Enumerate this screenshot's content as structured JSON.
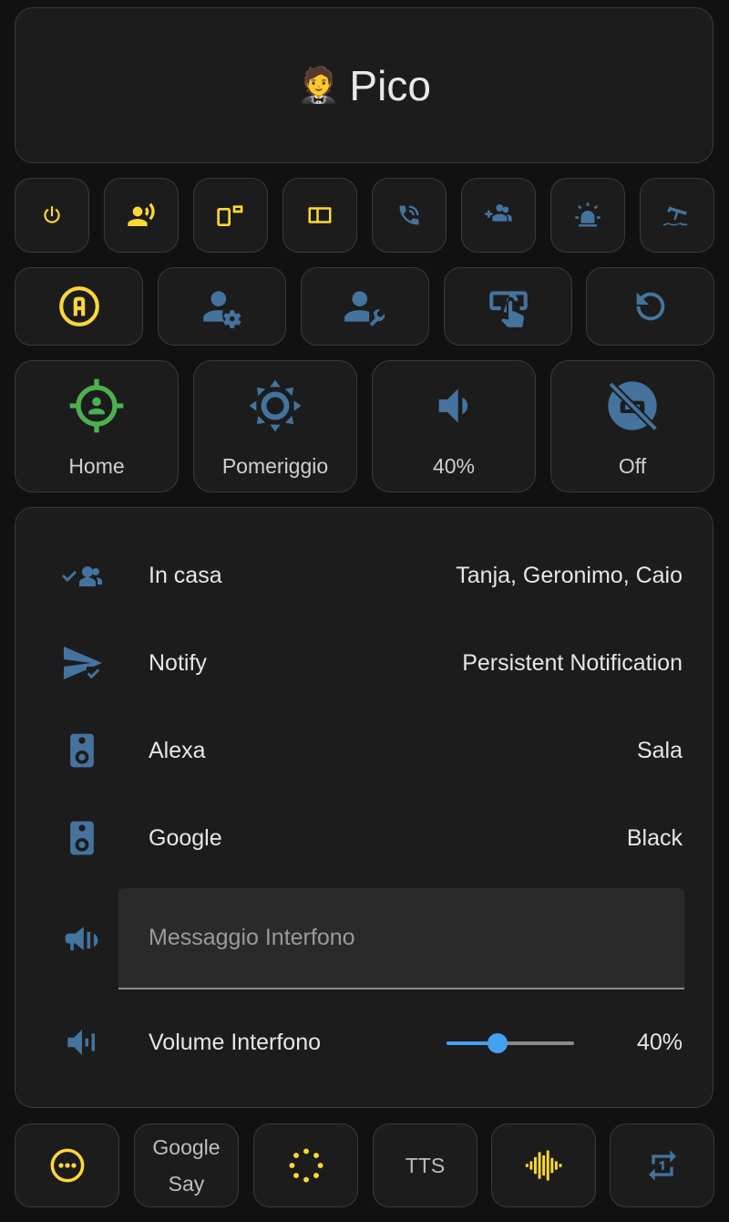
{
  "header": {
    "emoji": "🤵",
    "title": "Pico"
  },
  "colors": {
    "accent": "#fdd835",
    "icon_blue": "#44739e",
    "home_green": "#4caf50",
    "slider": "#44a1f2"
  },
  "row1_buttons": [
    {
      "icon": "power-icon",
      "color": "#fdd835"
    },
    {
      "icon": "account-voice-icon",
      "color": "#fdd835"
    },
    {
      "icon": "devices-icon",
      "color": "#fdd835"
    },
    {
      "icon": "page-layout-sidebar-icon",
      "color": "#fdd835"
    },
    {
      "icon": "phone-in-talk-icon",
      "color": "#44739e"
    },
    {
      "icon": "account-multiple-plus-icon",
      "color": "#44739e"
    },
    {
      "icon": "alarm-light-icon",
      "color": "#44739e"
    },
    {
      "icon": "beach-icon",
      "color": "#44739e"
    }
  ],
  "row2_buttons": [
    {
      "icon": "alpha-a-circle-icon",
      "color": "#fdd835"
    },
    {
      "icon": "account-cog-icon",
      "color": "#44739e"
    },
    {
      "icon": "account-wrench-icon",
      "color": "#44739e"
    },
    {
      "icon": "gesture-tap-button-icon",
      "color": "#44739e"
    },
    {
      "icon": "restart-icon",
      "color": "#44739e"
    }
  ],
  "tiles": [
    {
      "icon": "target-account-icon",
      "label": "Home",
      "color": "#4caf50"
    },
    {
      "icon": "brightness-icon",
      "label": "Pomeriggio",
      "color": "#44739e"
    },
    {
      "icon": "volume-medium-icon",
      "label": "40%",
      "color": "#44739e"
    },
    {
      "icon": "robot-off-icon",
      "label": "Off",
      "color": "#44739e"
    }
  ],
  "entities": {
    "rows": [
      {
        "icon": "account-multiple-check-icon",
        "name": "In casa",
        "value": "Tanja, Geronimo, Caio"
      },
      {
        "icon": "send-check-icon",
        "name": "Notify",
        "value": "Persistent Notification"
      },
      {
        "icon": "speaker-icon",
        "name": "Alexa",
        "value": "Sala"
      },
      {
        "icon": "speaker-icon",
        "name": "Google",
        "value": "Black"
      }
    ],
    "intercom": {
      "icon": "bullhorn-icon",
      "placeholder": "Messaggio Interfono"
    },
    "volume": {
      "icon": "volume-source-icon",
      "name": "Volume Interfono",
      "value": "40%",
      "level": 0.4
    }
  },
  "bottom_buttons": [
    {
      "icon": "dots-horizontal-circle-icon",
      "label": ""
    },
    {
      "icon": "",
      "label": "Google Say"
    },
    {
      "icon": "dots-circle-icon",
      "label": ""
    },
    {
      "icon": "",
      "label": "TTS"
    },
    {
      "icon": "waveform-icon",
      "label": ""
    },
    {
      "icon": "repeat-once-icon",
      "label": ""
    }
  ]
}
